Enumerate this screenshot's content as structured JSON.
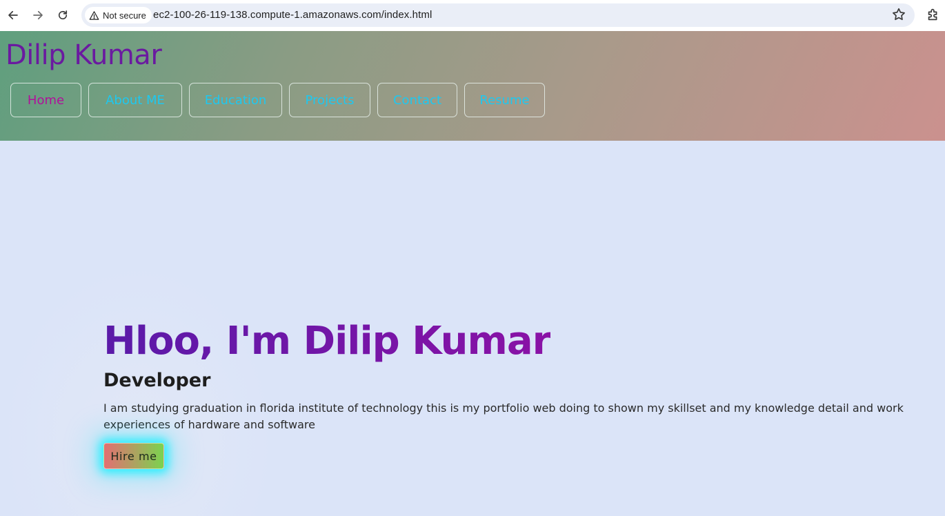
{
  "browser": {
    "security_label": "Not secure",
    "url": "ec2-100-26-119-138.compute-1.amazonaws.com/index.html"
  },
  "site": {
    "title": "Dilip Kumar",
    "nav": [
      {
        "label": "Home",
        "active": true
      },
      {
        "label": "About ME",
        "active": false
      },
      {
        "label": "Education",
        "active": false
      },
      {
        "label": "Projects",
        "active": false
      },
      {
        "label": "Contact",
        "active": false
      },
      {
        "label": "Resume",
        "active": false
      }
    ]
  },
  "hero": {
    "greeting": "Hloo, I'm Dilip Kumar",
    "role": "Developer",
    "description": "I am studying graduation in florida institute of technology this is my portfolio web doing to shown my skillset and my knowledge detail and work experiences of hardware and software",
    "cta_label": "Hire me"
  },
  "colors": {
    "title_purple": "#6a1aa0",
    "nav_cyan": "#1ec8f0",
    "nav_active": "#b0109a",
    "page_bg": "#dbe4f8"
  }
}
